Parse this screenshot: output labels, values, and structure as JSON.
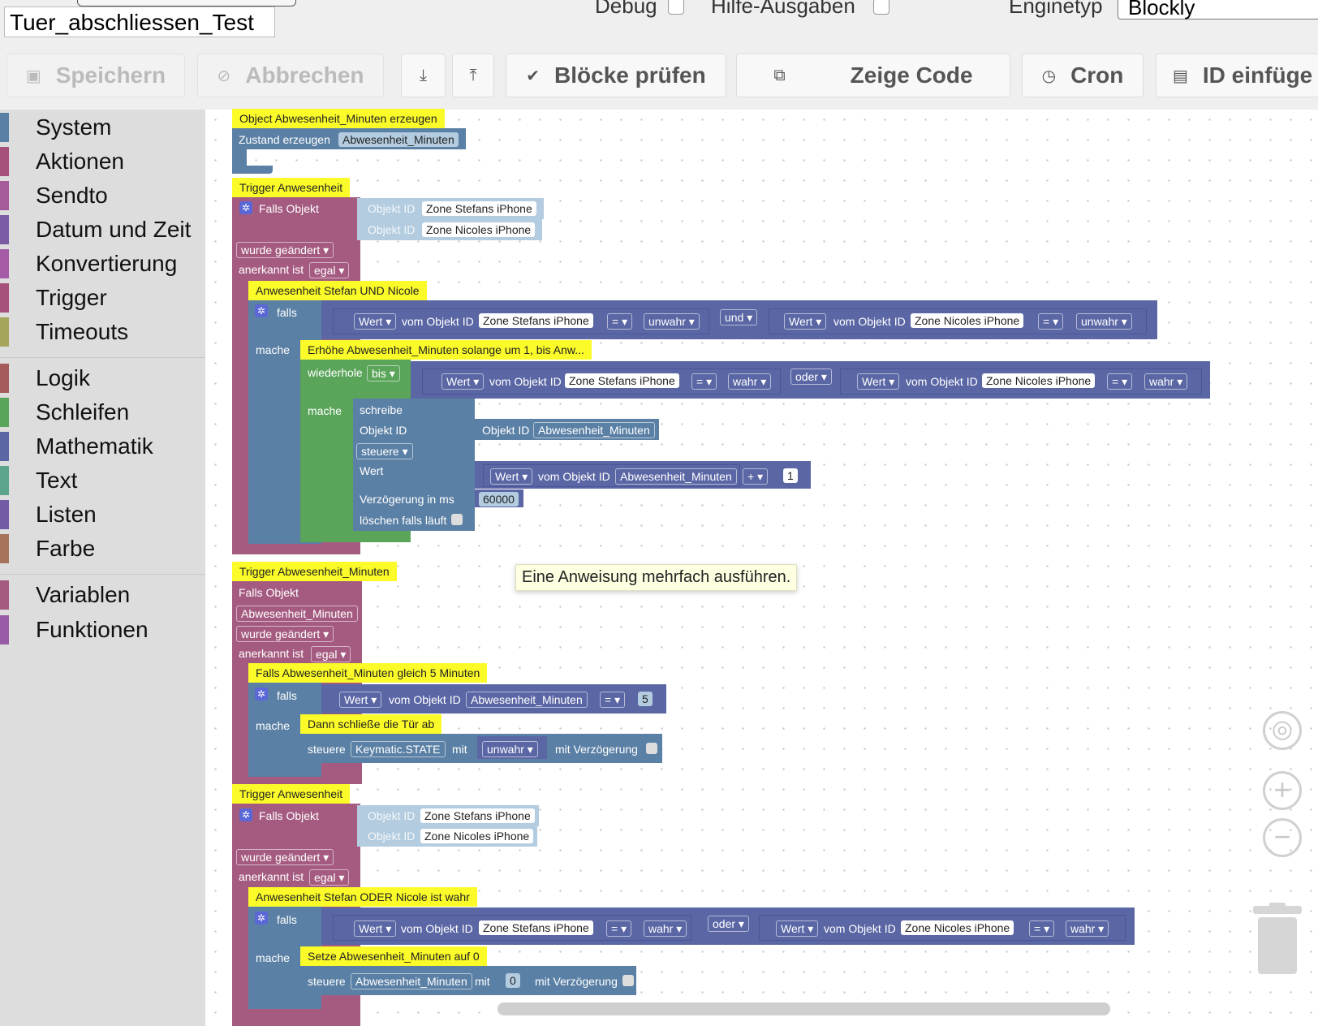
{
  "header": {
    "script_name": "Tuer_abschliessen_Test",
    "debug_label": "Debug",
    "help_label": "Hilfe-Ausgaben",
    "engine_label": "Enginetyp",
    "engine_value": "Blockly"
  },
  "toolbar": {
    "save": "Speichern",
    "cancel": "Abbrechen",
    "check_blocks": "Blöcke prüfen",
    "show_code": "Zeige Code",
    "cron": "Cron",
    "insert_id": "ID einfüge"
  },
  "sidebar": {
    "categories": [
      {
        "label": "System",
        "color": "#5b80a5"
      },
      {
        "label": "Aktionen",
        "color": "#a5507a"
      },
      {
        "label": "Sendto",
        "color": "#a55b99"
      },
      {
        "label": "Datum und Zeit",
        "color": "#7a5ba5"
      },
      {
        "label": "Konvertierung",
        "color": "#a55ba5"
      },
      {
        "label": "Trigger",
        "color": "#a5507a"
      },
      {
        "label": "Timeouts",
        "color": "#a5a55b"
      },
      {
        "label": "Logik",
        "color": "#a55b5b"
      },
      {
        "label": "Schleifen",
        "color": "#5ba55b"
      },
      {
        "label": "Mathematik",
        "color": "#5b67a5"
      },
      {
        "label": "Text",
        "color": "#5ba58c"
      },
      {
        "label": "Listen",
        "color": "#745ba5"
      },
      {
        "label": "Farbe",
        "color": "#a5745b"
      },
      {
        "label": "Variablen",
        "color": "#a55b80"
      },
      {
        "label": "Funktionen",
        "color": "#995ba5"
      }
    ]
  },
  "blocks": {
    "c1": "Object Abwesenheit_Minuten erzeugen",
    "create_state": "Zustand erzeugen",
    "state_name": "Abwesenheit_Minuten",
    "c2": "Trigger Anwesenheit",
    "falls_objekt": "Falls Objekt",
    "objekt_id": "Objekt ID",
    "zone_stefan": "Zone Stefans iPhone",
    "zone_nicole": "Zone Nicoles iPhone",
    "wurde_geaendert": "wurde geändert",
    "anerkannt_ist": "anerkannt ist",
    "egal": "egal",
    "c3": "Anwesenheit Stefan UND Nicole",
    "falls": "falls",
    "mache": "mache",
    "wert": "Wert",
    "vom_objekt_id": "vom Objekt ID",
    "eq": "=",
    "unwahr": "unwahr",
    "wahr": "wahr",
    "und": "und",
    "oder": "oder",
    "c4": "Erhöhe Abwesenheit_Minuten solange um 1, bis Anw...",
    "wiederhole": "wiederhole",
    "bis": "bis",
    "schreibe": "schreibe",
    "steuere": "steuere",
    "plus": "+",
    "one": "1",
    "delay_label": "Verzögerung in ms",
    "delay_value": "60000",
    "clear_running": "löschen falls läuft",
    "c5": "Trigger Abwesenheit_Minuten",
    "c6": "Falls Abwesenheit_Minuten gleich 5 Minuten",
    "five": "5",
    "c7": "Dann schließe die Tür ab",
    "keymatic": "Keymatic.STATE",
    "mit": "mit",
    "mit_verzoegerung": "mit Verzögerung",
    "c8": "Trigger Anwesenheit",
    "c9": "Anwesenheit Stefan ODER Nicole ist wahr",
    "c10": "Setze Abwesenheit_Minuten auf 0",
    "zero": "0"
  },
  "tooltip": "Eine Anweisung mehrfach ausführen.",
  "colors": {
    "trigger": "#a55b80",
    "control": "#5b80a5",
    "logic": "#5b67a5",
    "loop": "#5ba55b",
    "field_light": "#b3cce0",
    "comment": "#fbfb2a"
  }
}
